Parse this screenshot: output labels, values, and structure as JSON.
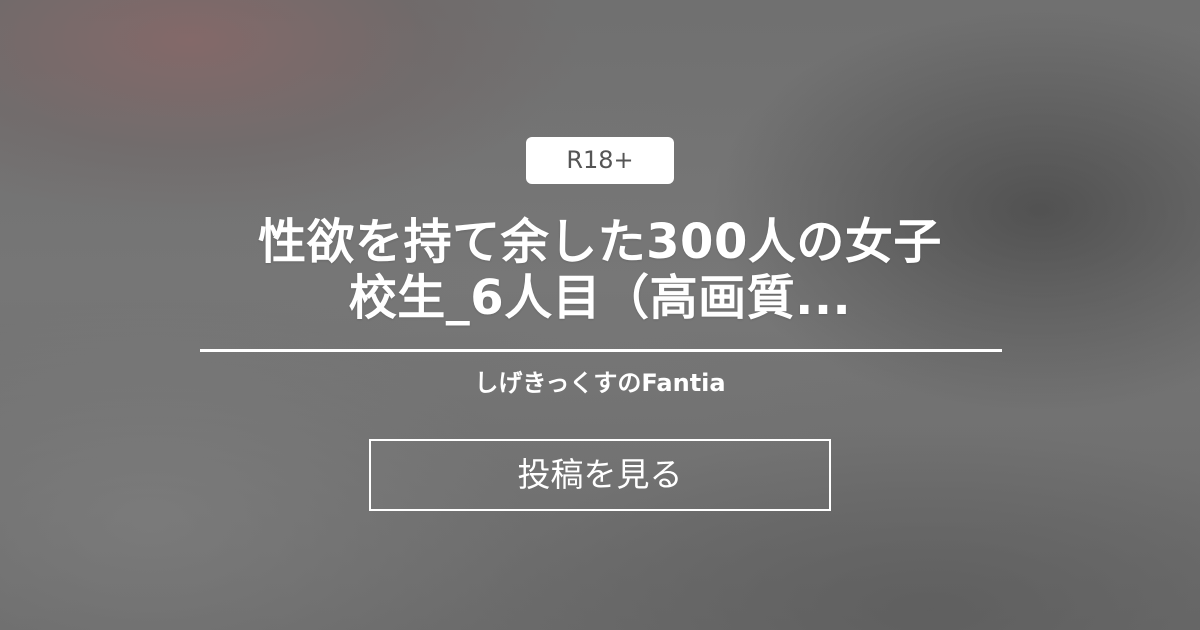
{
  "page": {
    "badge": "R18+",
    "title_lines": [
      "性欲を持て余した300人の女子",
      "校生_6人目（高画質..."
    ],
    "creator": "しげきっくすのFantia",
    "cta_label": "投稿を見る"
  },
  "colors": {
    "background": "#6f6f6f",
    "badge_bg": "#ffffff",
    "badge_text": "#555555",
    "text": "#ffffff",
    "divider": "#ffffff",
    "button_border": "#ffffff"
  }
}
